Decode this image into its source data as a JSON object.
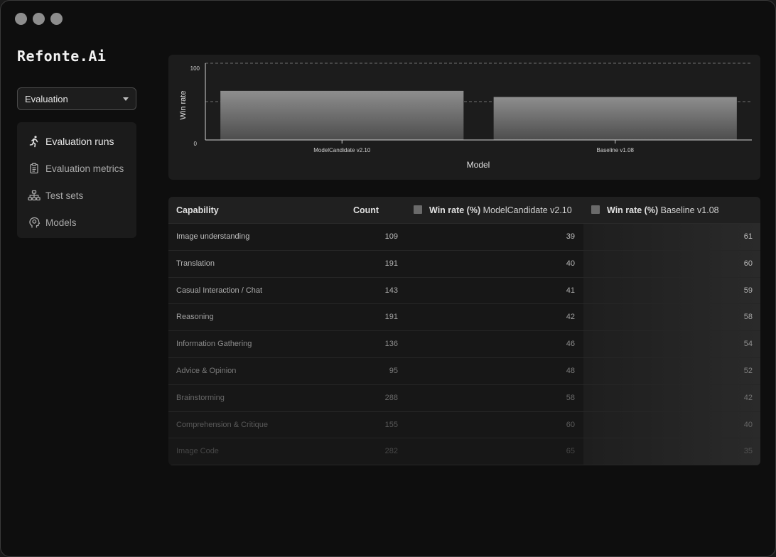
{
  "app": {
    "logo_text": "Refonte.Ai"
  },
  "sidebar": {
    "select_value": "Evaluation",
    "items": [
      {
        "label": "Evaluation runs",
        "icon": "running-person-icon",
        "active": true
      },
      {
        "label": "Evaluation metrics",
        "icon": "clipboard-icon",
        "active": false
      },
      {
        "label": "Test sets",
        "icon": "hierarchy-icon",
        "active": false
      },
      {
        "label": "Models",
        "icon": "brain-head-icon",
        "active": false
      }
    ]
  },
  "chart_data": {
    "type": "bar",
    "categories": [
      "ModelCandidate v2.10",
      "Baseline v1.08"
    ],
    "values": [
      64,
      56
    ],
    "xlabel": "Model",
    "ylabel": "Win rate",
    "ylim": [
      0,
      100
    ],
    "yticks": [
      "0",
      "100"
    ],
    "reference_lines": [
      100,
      50
    ],
    "grid": false
  },
  "table": {
    "headers": {
      "capability": "Capability",
      "count": "Count",
      "winrate_prefix": "Win rate (%)",
      "candidate": "ModelCandidate v2.10",
      "baseline": "Baseline v1.08"
    },
    "rows": [
      {
        "capability": "Image understanding",
        "count": "109",
        "candidate": "39",
        "baseline": "61"
      },
      {
        "capability": "Translation",
        "count": "191",
        "candidate": "40",
        "baseline": "60"
      },
      {
        "capability": "Casual Interaction / Chat",
        "count": "143",
        "candidate": "41",
        "baseline": "59"
      },
      {
        "capability": "Reasoning",
        "count": "191",
        "candidate": "42",
        "baseline": "58"
      },
      {
        "capability": "Information Gathering",
        "count": "136",
        "candidate": "46",
        "baseline": "54"
      },
      {
        "capability": "Advice & Opinion",
        "count": "95",
        "candidate": "48",
        "baseline": "52"
      },
      {
        "capability": "Brainstorming",
        "count": "288",
        "candidate": "58",
        "baseline": "42"
      },
      {
        "capability": "Comprehension & Critique",
        "count": "155",
        "candidate": "60",
        "baseline": "40"
      },
      {
        "capability": "Image Code",
        "count": "282",
        "candidate": "65",
        "baseline": "35"
      }
    ]
  }
}
